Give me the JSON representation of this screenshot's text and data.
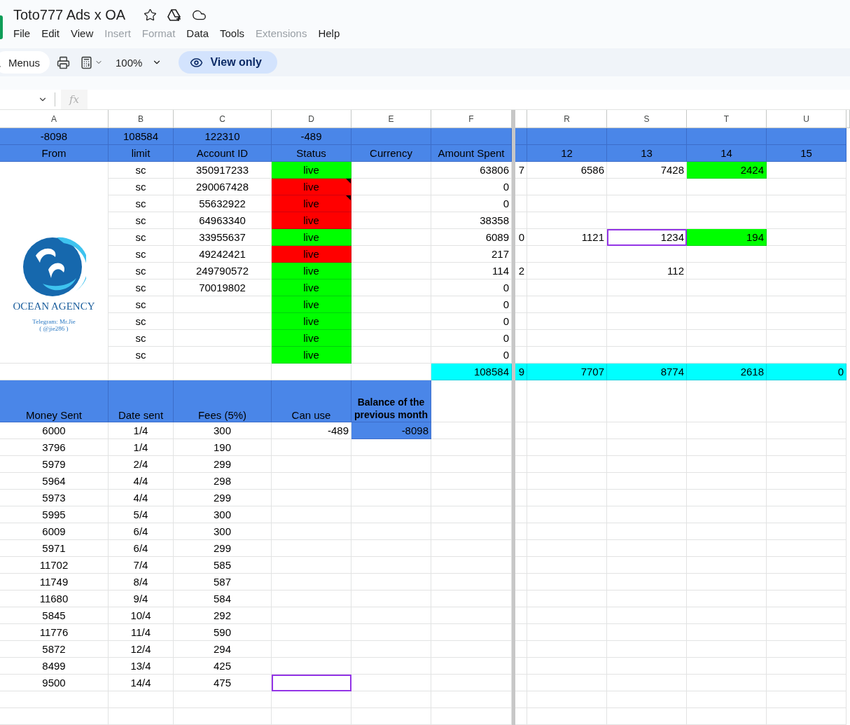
{
  "document": {
    "title": "Toto777 Ads x OA"
  },
  "menu": [
    {
      "label": "File",
      "disabled": false
    },
    {
      "label": "Edit",
      "disabled": false
    },
    {
      "label": "View",
      "disabled": false
    },
    {
      "label": "Insert",
      "disabled": true
    },
    {
      "label": "Format",
      "disabled": true
    },
    {
      "label": "Data",
      "disabled": false
    },
    {
      "label": "Tools",
      "disabled": false
    },
    {
      "label": "Extensions",
      "disabled": true
    },
    {
      "label": "Help",
      "disabled": false
    }
  ],
  "toolbar": {
    "search_label": "Menus",
    "zoom": "100%",
    "mode": "View only"
  },
  "formula_bar": {
    "label": "fx"
  },
  "logo": {
    "name": "OCEAN AGENCY",
    "caption": [
      "Telegram: Mr.Jie",
      "( @jie286 )"
    ]
  },
  "sheet": {
    "columns": [
      "A",
      "B",
      "C",
      "D",
      "E",
      "F",
      null,
      "R",
      "S",
      "T",
      "U"
    ],
    "rows": [
      {
        "kind": "summary",
        "cells": [
          "-8098",
          "108584",
          "122310",
          "-489",
          null,
          null,
          null,
          null,
          null,
          null,
          null
        ]
      },
      {
        "kind": "header",
        "cells": [
          "From",
          "limit",
          "Account ID",
          "Status",
          "Currency",
          "Amount Spent",
          null,
          "12",
          "13",
          "14",
          "15"
        ]
      },
      {
        "kind": "data",
        "cells": [
          null,
          "sc",
          "350917233",
          {
            "text": "live",
            "color": "#00ff00"
          },
          null,
          "63806",
          "7",
          "6586",
          "7428",
          {
            "text": "2424",
            "color": "#00ff00"
          },
          null
        ]
      },
      {
        "kind": "data",
        "cells": [
          null,
          "sc",
          "290067428",
          {
            "text": "live",
            "color": "#ff0000",
            "note": true
          },
          null,
          "0",
          null,
          null,
          null,
          null,
          null
        ]
      },
      {
        "kind": "data",
        "cells": [
          null,
          "sc",
          "55632922",
          {
            "text": "live",
            "color": "#ff0000",
            "note": true
          },
          null,
          "0",
          null,
          null,
          null,
          null,
          null
        ]
      },
      {
        "kind": "data",
        "cells": [
          null,
          "sc",
          "64963340",
          {
            "text": "live",
            "color": "#ff0000"
          },
          null,
          "38358",
          null,
          null,
          null,
          null,
          null
        ]
      },
      {
        "kind": "data",
        "cells": [
          null,
          "sc",
          "33955637",
          {
            "text": "live",
            "color": "#00ff00"
          },
          null,
          "6089",
          "0",
          "1121",
          {
            "text": "1234",
            "selected": true
          },
          {
            "text": "194",
            "color": "#00ff00"
          },
          null
        ]
      },
      {
        "kind": "data",
        "cells": [
          null,
          "sc",
          "49242421",
          {
            "text": "live",
            "color": "#ff0000"
          },
          null,
          "217",
          null,
          null,
          null,
          null,
          null
        ]
      },
      {
        "kind": "data",
        "cells": [
          null,
          "sc",
          "249790572",
          {
            "text": "live",
            "color": "#00ff00"
          },
          null,
          "114",
          "2",
          null,
          "112",
          null,
          null
        ]
      },
      {
        "kind": "data",
        "cells": [
          null,
          "sc",
          "70019802",
          {
            "text": "live",
            "color": "#00ff00"
          },
          null,
          "0",
          null,
          null,
          null,
          null,
          null
        ]
      },
      {
        "kind": "data",
        "cells": [
          null,
          "sc",
          null,
          {
            "text": "live",
            "color": "#00ff00"
          },
          null,
          "0",
          null,
          null,
          null,
          null,
          null
        ]
      },
      {
        "kind": "data",
        "cells": [
          null,
          "sc",
          null,
          {
            "text": "live",
            "color": "#00ff00"
          },
          null,
          "0",
          null,
          null,
          null,
          null,
          null
        ]
      },
      {
        "kind": "data",
        "cells": [
          null,
          "sc",
          null,
          {
            "text": "live",
            "color": "#00ff00"
          },
          null,
          "0",
          null,
          null,
          null,
          null,
          null
        ]
      },
      {
        "kind": "data",
        "cells": [
          null,
          "sc",
          null,
          {
            "text": "live",
            "color": "#00ff00"
          },
          null,
          "0",
          null,
          null,
          null,
          null,
          null
        ]
      },
      {
        "kind": "total",
        "cells": [
          null,
          null,
          null,
          null,
          null,
          "108584",
          "9",
          "7707",
          "8774",
          "2618",
          "0"
        ]
      },
      {
        "kind": "subheader",
        "cells": [
          "Money Sent",
          "Date sent",
          "Fees (5%)",
          "Can use",
          {
            "text": "Balance of the previous month",
            "bold": true
          },
          null,
          null,
          null,
          null,
          null,
          null
        ]
      },
      {
        "kind": "entry",
        "cells": [
          "6000",
          "1/4",
          "300",
          "-489",
          {
            "text": "-8098",
            "color": "#4a86e8"
          },
          null,
          null,
          null,
          null,
          null,
          null
        ]
      },
      {
        "kind": "entry",
        "cells": [
          "3796",
          "1/4",
          "190",
          null,
          null,
          null,
          null,
          null,
          null,
          null,
          null
        ]
      },
      {
        "kind": "entry",
        "cells": [
          "5979",
          "2/4",
          "299",
          null,
          null,
          null,
          null,
          null,
          null,
          null,
          null
        ]
      },
      {
        "kind": "entry",
        "cells": [
          "5964",
          "4/4",
          "298",
          null,
          null,
          null,
          null,
          null,
          null,
          null,
          null
        ]
      },
      {
        "kind": "entry",
        "cells": [
          "5973",
          "4/4",
          "299",
          null,
          null,
          null,
          null,
          null,
          null,
          null,
          null
        ]
      },
      {
        "kind": "entry",
        "cells": [
          "5995",
          "5/4",
          "300",
          null,
          null,
          null,
          null,
          null,
          null,
          null,
          null
        ]
      },
      {
        "kind": "entry",
        "cells": [
          "6009",
          "6/4",
          "300",
          null,
          null,
          null,
          null,
          null,
          null,
          null,
          null
        ]
      },
      {
        "kind": "entry",
        "cells": [
          "5971",
          "6/4",
          "299",
          null,
          null,
          null,
          null,
          null,
          null,
          null,
          null
        ]
      },
      {
        "kind": "entry",
        "cells": [
          "11702",
          "7/4",
          "585",
          null,
          null,
          null,
          null,
          null,
          null,
          null,
          null
        ]
      },
      {
        "kind": "entry",
        "cells": [
          "11749",
          "8/4",
          "587",
          null,
          null,
          null,
          null,
          null,
          null,
          null,
          null
        ]
      },
      {
        "kind": "entry",
        "cells": [
          "11680",
          "9/4",
          "584",
          null,
          null,
          null,
          null,
          null,
          null,
          null,
          null
        ]
      },
      {
        "kind": "entry",
        "cells": [
          "5845",
          "10/4",
          "292",
          null,
          null,
          null,
          null,
          null,
          null,
          null,
          null
        ]
      },
      {
        "kind": "entry",
        "cells": [
          "11776",
          "11/4",
          "590",
          null,
          null,
          null,
          null,
          null,
          null,
          null,
          null
        ]
      },
      {
        "kind": "entry",
        "cells": [
          "5872",
          "12/4",
          "294",
          null,
          null,
          null,
          null,
          null,
          null,
          null,
          null
        ]
      },
      {
        "kind": "entry",
        "cells": [
          "8499",
          "13/4",
          "425",
          null,
          null,
          null,
          null,
          null,
          null,
          null,
          null
        ]
      },
      {
        "kind": "entry",
        "cells": [
          "9500",
          "14/4",
          "475",
          {
            "selected": true
          },
          null,
          null,
          null,
          null,
          null,
          null,
          null
        ]
      }
    ]
  }
}
